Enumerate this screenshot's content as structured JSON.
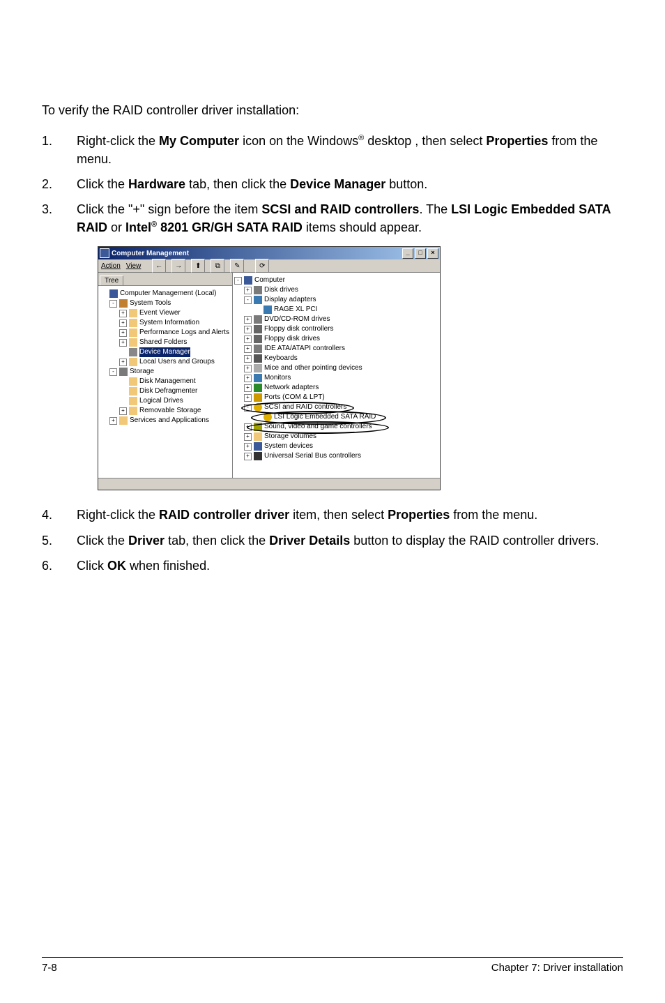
{
  "intro": "To verify the RAID controller driver installation:",
  "steps": [
    {
      "num": "1.",
      "parts": [
        "Right-click the ",
        {
          "b": "My Computer"
        },
        " icon on the Windows",
        {
          "sup": "®"
        },
        " desktop , then select ",
        {
          "b": "Properties"
        },
        " from the menu."
      ]
    },
    {
      "num": "2.",
      "parts": [
        "Click the ",
        {
          "b": "Hardware"
        },
        " tab, then click the ",
        {
          "b": "Device Manager"
        },
        " button."
      ]
    },
    {
      "num": "3.",
      "parts": [
        "Click the \"+\" sign before the item ",
        {
          "b": "SCSI and RAID controllers"
        },
        ". The ",
        {
          "b": "LSI Logic Embedded SATA RAID"
        },
        " or ",
        {
          "b": "Intel"
        },
        {
          "bsup": "®"
        },
        {
          "b": " 8201 GR/GH SATA RAID"
        },
        " items should appear."
      ]
    }
  ],
  "steps2": [
    {
      "num": "4.",
      "parts": [
        "Right-click the ",
        {
          "b": "RAID controller driver"
        },
        " item, then select ",
        {
          "b": "Properties"
        },
        " from the menu."
      ]
    },
    {
      "num": "5.",
      "parts": [
        "Click the ",
        {
          "b": "Driver"
        },
        " tab, then click the ",
        {
          "b": "Driver Details"
        },
        " button to display the RAID controller drivers."
      ]
    },
    {
      "num": "6.",
      "parts": [
        "Click ",
        {
          "b": "OK"
        },
        " when finished."
      ]
    }
  ],
  "window": {
    "title": "Computer Management",
    "winbuttons": [
      "_",
      "□",
      "×"
    ],
    "menu": [
      "Action",
      "View"
    ],
    "toolbar_icons": [
      "←",
      "→",
      "⬆",
      "⧉",
      "✎",
      "⟳"
    ],
    "tab_left": "Tree",
    "left_tree": [
      {
        "lvl": 0,
        "pm": "",
        "ic": "ic-comp",
        "label": "Computer Management (Local)"
      },
      {
        "lvl": 1,
        "pm": "-",
        "ic": "ic-tools",
        "label": "System Tools"
      },
      {
        "lvl": 2,
        "pm": "+",
        "ic": "ic-folder",
        "label": "Event Viewer"
      },
      {
        "lvl": 2,
        "pm": "+",
        "ic": "ic-folder",
        "label": "System Information"
      },
      {
        "lvl": 2,
        "pm": "+",
        "ic": "ic-folder",
        "label": "Performance Logs and Alerts"
      },
      {
        "lvl": 2,
        "pm": "+",
        "ic": "ic-folder",
        "label": "Shared Folders"
      },
      {
        "lvl": 2,
        "pm": "",
        "ic": "ic-gear",
        "label": "Device Manager",
        "sel": true
      },
      {
        "lvl": 2,
        "pm": "+",
        "ic": "ic-folder",
        "label": "Local Users and Groups"
      },
      {
        "lvl": 1,
        "pm": "-",
        "ic": "ic-disk",
        "label": "Storage"
      },
      {
        "lvl": 2,
        "pm": "",
        "ic": "ic-folder",
        "label": "Disk Management"
      },
      {
        "lvl": 2,
        "pm": "",
        "ic": "ic-folder",
        "label": "Disk Defragmenter"
      },
      {
        "lvl": 2,
        "pm": "",
        "ic": "ic-folder",
        "label": "Logical Drives"
      },
      {
        "lvl": 2,
        "pm": "+",
        "ic": "ic-folder",
        "label": "Removable Storage"
      },
      {
        "lvl": 1,
        "pm": "+",
        "ic": "ic-folder",
        "label": "Services and Applications"
      }
    ],
    "right_tree": [
      {
        "lvl": 0,
        "pm": "-",
        "ic": "ic-comp",
        "label": "Computer"
      },
      {
        "lvl": 1,
        "pm": "+",
        "ic": "ic-disk",
        "label": "Disk drives"
      },
      {
        "lvl": 1,
        "pm": "-",
        "ic": "ic-monitor",
        "label": "Display adapters"
      },
      {
        "lvl": 2,
        "pm": "",
        "ic": "ic-monitor",
        "label": "RAGE XL  PCI"
      },
      {
        "lvl": 1,
        "pm": "+",
        "ic": "ic-disk",
        "label": "DVD/CD-ROM drives"
      },
      {
        "lvl": 1,
        "pm": "+",
        "ic": "ic-floppy",
        "label": "Floppy disk controllers"
      },
      {
        "lvl": 1,
        "pm": "+",
        "ic": "ic-floppy",
        "label": "Floppy disk drives"
      },
      {
        "lvl": 1,
        "pm": "+",
        "ic": "ic-disk",
        "label": "IDE ATA/ATAPI controllers"
      },
      {
        "lvl": 1,
        "pm": "+",
        "ic": "ic-kb",
        "label": "Keyboards"
      },
      {
        "lvl": 1,
        "pm": "+",
        "ic": "ic-mouse",
        "label": "Mice and other pointing devices"
      },
      {
        "lvl": 1,
        "pm": "+",
        "ic": "ic-monitor",
        "label": "Monitors"
      },
      {
        "lvl": 1,
        "pm": "+",
        "ic": "ic-net",
        "label": "Network adapters"
      },
      {
        "lvl": 1,
        "pm": "+",
        "ic": "ic-port",
        "label": "Ports (COM & LPT)"
      },
      {
        "lvl": 1,
        "pm": "-",
        "ic": "ic-scsi",
        "label": "SCSI and RAID controllers",
        "oval": "top"
      },
      {
        "lvl": 2,
        "pm": "",
        "ic": "ic-scsi",
        "label": "LSI Logic Embedded SATA RAID",
        "oval": "item"
      },
      {
        "lvl": 1,
        "pm": "+",
        "ic": "ic-sound",
        "label": "Sound, video and game controllers",
        "oval": "bottom"
      },
      {
        "lvl": 1,
        "pm": "+",
        "ic": "ic-folder",
        "label": "Storage volumes"
      },
      {
        "lvl": 1,
        "pm": "+",
        "ic": "ic-comp",
        "label": "System devices"
      },
      {
        "lvl": 1,
        "pm": "+",
        "ic": "ic-usb",
        "label": "Universal Serial Bus controllers"
      }
    ]
  },
  "footer": {
    "left": "7-8",
    "right": "Chapter 7: Driver installation"
  }
}
